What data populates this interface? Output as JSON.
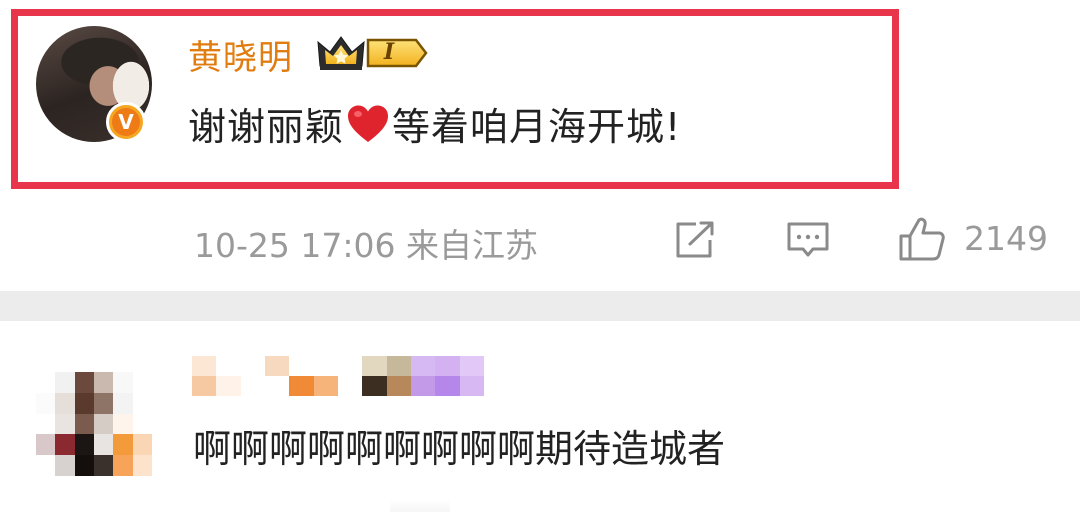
{
  "comment1": {
    "author": "黄晓明",
    "verified_badge": "V",
    "member_level": "I",
    "text_before_heart": "谢谢丽颖",
    "heart_icon": "red-heart-emoji",
    "text_after_heart": "等着咱月海开城!",
    "timestamp_location": "10-25 17:06 来自江苏",
    "like_count": "2149",
    "highlight_color": "#e8354b",
    "author_color": "#e17d10"
  },
  "comment2": {
    "author_obscured": true,
    "text": "啊啊啊啊啊啊啊啊啊期待造城者"
  }
}
